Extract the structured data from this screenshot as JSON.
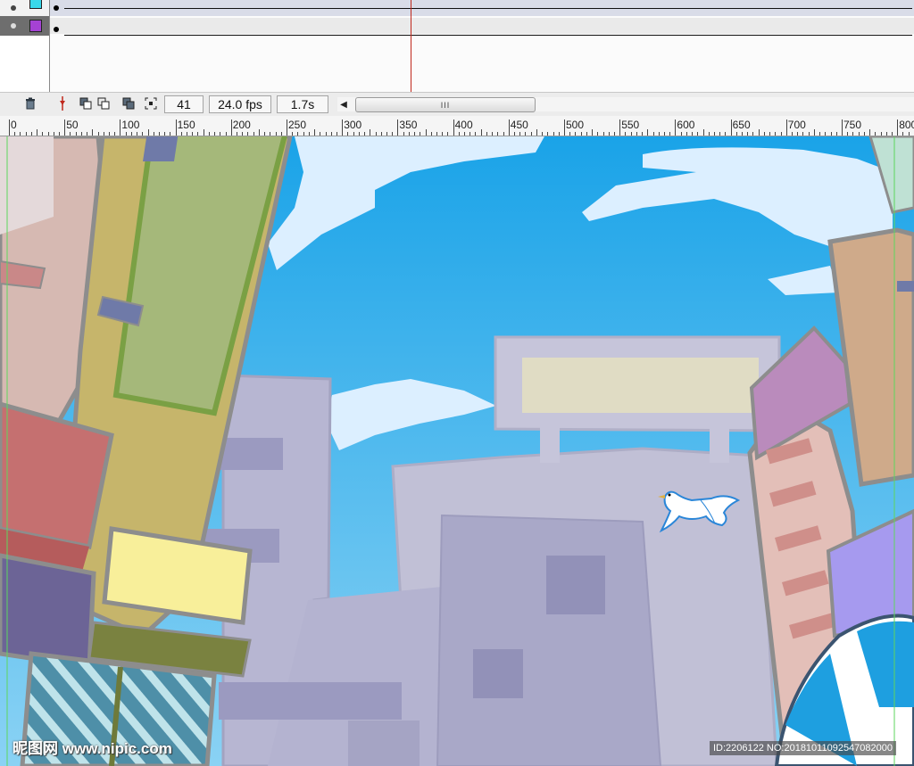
{
  "timeline": {
    "layers": [
      {
        "color": "#39d9ea"
      },
      {
        "color": "#a542d4",
        "selected": true
      }
    ],
    "current_frame": "41",
    "frame_rate": "24.0 fps",
    "elapsed_time": "1.7s",
    "scroll_thumb_label": "III"
  },
  "ruler": {
    "labels": [
      "0",
      "50",
      "100",
      "150",
      "200",
      "250",
      "300",
      "350",
      "400",
      "450",
      "500",
      "550",
      "600",
      "650",
      "700",
      "750",
      "800"
    ]
  },
  "stage": {
    "sky_color": "#3ea8e8",
    "billboard_color": "#e0dcc4",
    "sign_color": "#f8ef9a",
    "bird": "dove"
  },
  "watermark": "昵图网 www.nipic.com",
  "id_stamp": "ID:2206122 NO:20181011092547082000"
}
